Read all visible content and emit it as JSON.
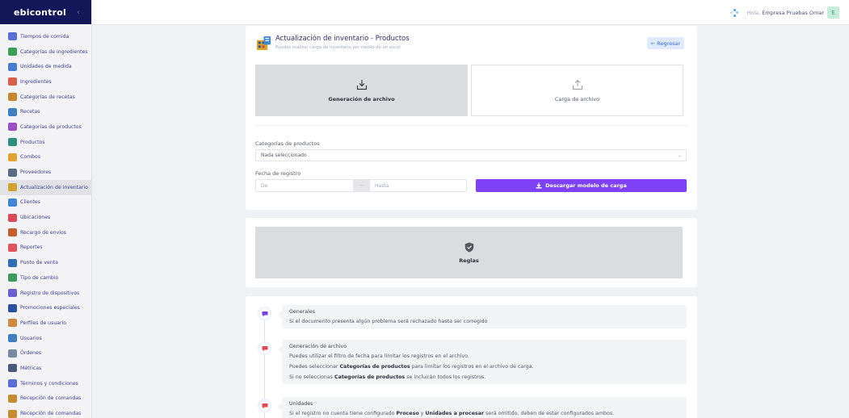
{
  "app": {
    "logo": "ebicontrol",
    "collapse_icon": "chevron-left-icon"
  },
  "sidebar": {
    "items": [
      {
        "label": "Tiempos de comida",
        "icon": "utensils-icon",
        "color": "#5b6ed6"
      },
      {
        "label": "Categorías de ingredientes",
        "icon": "ingredients-category-icon",
        "color": "#3a9e57"
      },
      {
        "label": "Unidades de medida",
        "icon": "scale-icon",
        "color": "#4a7bd3"
      },
      {
        "label": "Ingredientes",
        "icon": "ingredients-icon",
        "color": "#d8604c"
      },
      {
        "label": "Categorías de recetas",
        "icon": "recipe-category-icon",
        "color": "#c9842f"
      },
      {
        "label": "Recetas",
        "icon": "recipe-icon",
        "color": "#3f7fc1"
      },
      {
        "label": "Categorías de productos",
        "icon": "product-category-icon",
        "color": "#9b4fc2"
      },
      {
        "label": "Productos",
        "icon": "products-icon",
        "color": "#2d8e7d"
      },
      {
        "label": "Combos",
        "icon": "combo-icon",
        "color": "#e0a332"
      },
      {
        "label": "Proveedores",
        "icon": "supplier-icon",
        "color": "#5c6a86"
      },
      {
        "label": "Actualización de inventario",
        "icon": "inventory-update-icon",
        "color": "#d4a02c",
        "active": true
      },
      {
        "label": "Clientes",
        "icon": "clients-icon",
        "color": "#3f86d6"
      },
      {
        "label": "Ubicaciones",
        "icon": "location-icon",
        "color": "#d94a59"
      },
      {
        "label": "Recargo de envíos",
        "icon": "shipping-icon",
        "color": "#c55c2b"
      },
      {
        "label": "Reportes",
        "icon": "reports-icon",
        "color": "#e1535d"
      },
      {
        "label": "Punto de venta",
        "icon": "pos-icon",
        "color": "#2f6fb8"
      },
      {
        "label": "Tipo de cambio",
        "icon": "exchange-icon",
        "color": "#3c9b5a"
      },
      {
        "label": "Registro de dispositivos",
        "icon": "devices-icon",
        "color": "#6a5ed3"
      },
      {
        "label": "Promociones especiales",
        "icon": "promotions-icon",
        "color": "#2c4fa3"
      },
      {
        "label": "Perfiles de usuario",
        "icon": "user-profile-icon",
        "color": "#d1883b"
      },
      {
        "label": "Usuarios",
        "icon": "users-icon",
        "color": "#3f7fc1"
      },
      {
        "label": "Órdenes",
        "icon": "orders-icon",
        "color": "#7a8aa5"
      },
      {
        "label": "Métricas",
        "icon": "metrics-icon",
        "color": "#4b5a7a"
      },
      {
        "label": "Términos y condiciones",
        "icon": "terms-icon",
        "color": "#5b6ed6"
      },
      {
        "label": "Recepción de comandas",
        "icon": "orders-reception-icon",
        "color": "#c68c2e"
      },
      {
        "label": "Recepción de comandas",
        "icon": "orders-reception-icon",
        "color": "#c68c2e"
      }
    ]
  },
  "topbar": {
    "greeting": "Hola,",
    "user_name": "Empresa Pruebas Omar",
    "avatar_letter": "E"
  },
  "header": {
    "title": "Actualización de inventario - Productos",
    "subtitle": "Puedes realizar carga de inventario por medio de un excel",
    "back_label": "← Regresar"
  },
  "tiles": {
    "generate_label": "Generación de archivo",
    "load_label": "Carga de archivo"
  },
  "filters": {
    "category_label": "Categorías de productos",
    "category_value": "Nada seleccionado",
    "date_label": "Fecha de registro",
    "date_from_placeholder": "De",
    "date_sep": "···",
    "date_to_placeholder": "Hasta",
    "download_label": "Descargar modelo de carga"
  },
  "rules": {
    "label": "Reglas"
  },
  "timeline": {
    "generales": {
      "title": "Generales",
      "text": "Si el documento presenta algún problema será rechazado hasta ser corregido"
    },
    "generacion": {
      "title": "Generación de archivo",
      "line1": "Puedes utilizar el filtro de fecha para limitar los registros en el archivo.",
      "line2_pre": "Puedes seleccionar ",
      "line2_bold": "Categorías de productos",
      "line2_post": " para limitar los registros en el archivo de carga.",
      "line3_pre": "Si no seleccionas ",
      "line3_bold": "Categorías de productos",
      "line3_post": " se incluirán todos los registros."
    },
    "unidades": {
      "title": "Unidades",
      "pre": "Si el registro no cuenta tiene configurado ",
      "bold1": "Proceso",
      "mid": " y ",
      "bold2": "Unidades a procesar",
      "post": " será omitido, deben de estar configurados ambos."
    }
  },
  "colors": {
    "accent": "#7e41f5",
    "sidebar_header": "#14165a",
    "back_button": "#dfeafe",
    "tile_grey": "#dbdce0"
  }
}
